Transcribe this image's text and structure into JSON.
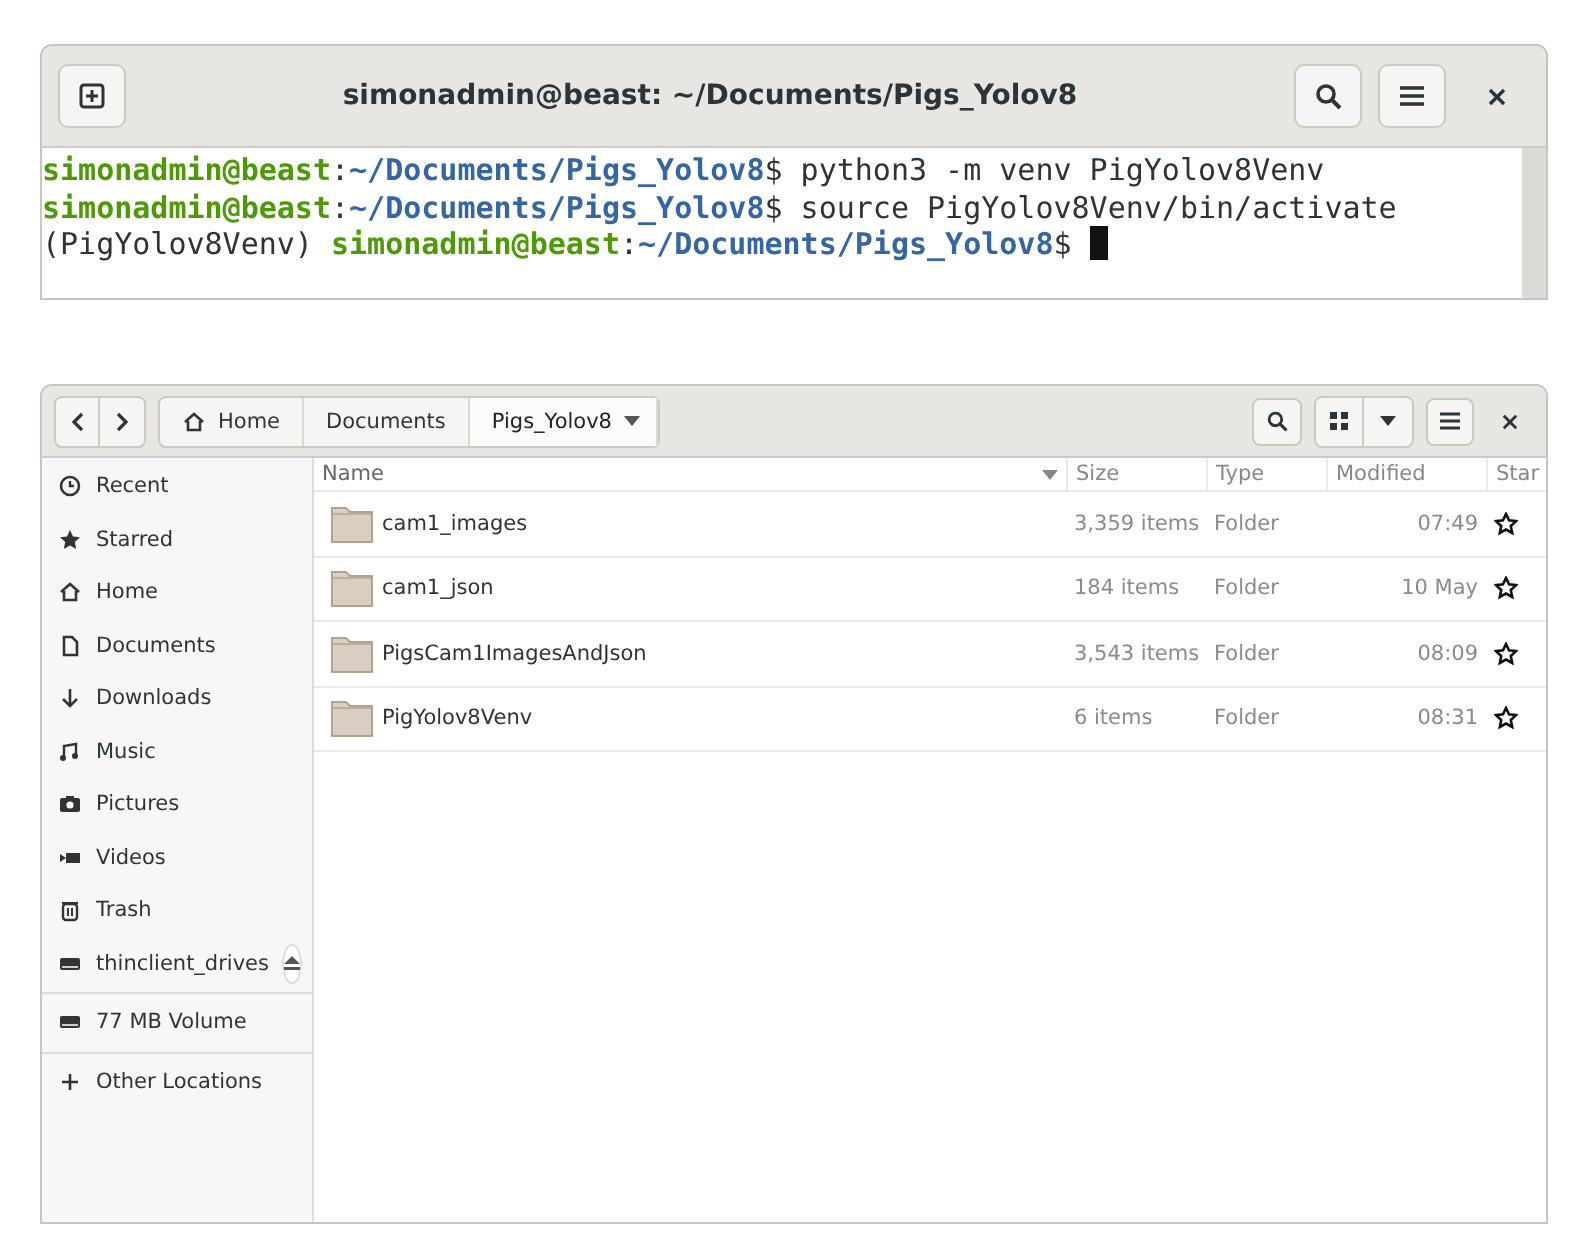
{
  "terminal": {
    "title": "simonadmin@beast: ~/Documents/Pigs_Yolov8",
    "lines": [
      [
        {
          "kind": "user",
          "text": "simonadmin@beast"
        },
        {
          "kind": "plain",
          "text": ":"
        },
        {
          "kind": "path",
          "text": "~/Documents/Pigs_Yolov8"
        },
        {
          "kind": "plain",
          "text": "$ python3 -m venv PigYolov8Venv"
        }
      ],
      [
        {
          "kind": "user",
          "text": "simonadmin@beast"
        },
        {
          "kind": "plain",
          "text": ":"
        },
        {
          "kind": "path",
          "text": "~/Documents/Pigs_Yolov8"
        },
        {
          "kind": "plain",
          "text": "$ source PigYolov8Venv/bin/activate"
        }
      ],
      [
        {
          "kind": "plain",
          "text": "(PigYolov8Venv) "
        },
        {
          "kind": "user",
          "text": "simonadmin@beast"
        },
        {
          "kind": "plain",
          "text": ":"
        },
        {
          "kind": "path",
          "text": "~/Documents/Pigs_Yolov8"
        },
        {
          "kind": "plain",
          "text": "$ "
        },
        {
          "kind": "cursor"
        }
      ]
    ]
  },
  "files": {
    "breadcrumb": [
      {
        "label": "Home",
        "selected": false
      },
      {
        "label": "Documents",
        "selected": false
      },
      {
        "label": "Pigs_Yolov8",
        "selected": true
      }
    ],
    "sidebar": [
      [
        {
          "label": "Recent",
          "ejectable": false
        },
        {
          "label": "Starred",
          "ejectable": false
        },
        {
          "label": "Home",
          "ejectable": false
        },
        {
          "label": "Documents",
          "ejectable": false
        },
        {
          "label": "Downloads",
          "ejectable": false
        },
        {
          "label": "Music",
          "ejectable": false
        },
        {
          "label": "Pictures",
          "ejectable": false
        },
        {
          "label": "Videos",
          "ejectable": false
        },
        {
          "label": "Trash",
          "ejectable": false
        },
        {
          "label": "thinclient_drives",
          "ejectable": true
        }
      ],
      [
        {
          "label": "77 MB Volume",
          "ejectable": false
        }
      ],
      [
        {
          "label": "Other Locations",
          "ejectable": false
        }
      ]
    ],
    "columns": [
      {
        "label": "Name",
        "sorted": true
      },
      {
        "label": "Size",
        "sorted": false
      },
      {
        "label": "Type",
        "sorted": false
      },
      {
        "label": "Modified",
        "sorted": false
      },
      {
        "label": "Star",
        "sorted": false
      }
    ],
    "rows": [
      {
        "name": "cam1_images",
        "size": "3,359 items",
        "type": "Folder",
        "modified": "07:49",
        "starred": false
      },
      {
        "name": "cam1_json",
        "size": "184 items",
        "type": "Folder",
        "modified": "10 May",
        "starred": false
      },
      {
        "name": "PigsCam1ImagesAndJson",
        "size": "3,543 items",
        "type": "Folder",
        "modified": "08:09",
        "starred": false
      },
      {
        "name": "PigYolov8Venv",
        "size": "6 items",
        "type": "Folder",
        "modified": "08:31",
        "starred": false
      }
    ]
  }
}
